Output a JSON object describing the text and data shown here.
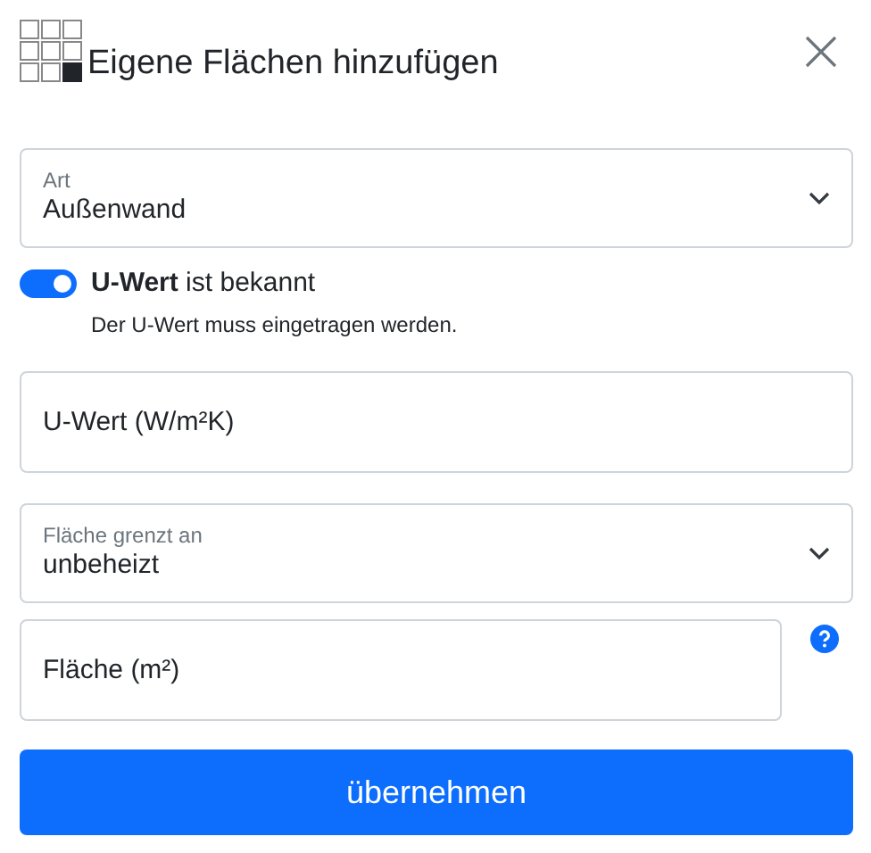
{
  "dialog": {
    "title": "Eigene Flächen hinzufügen"
  },
  "fields": [
    {
      "kind": "select",
      "label": "Art",
      "value": "Außenwand"
    },
    {
      "kind": "toggle",
      "label": "**U-Wert** ist bekannt",
      "on": true,
      "hint": "Der U-Wert muss eingetragen werden."
    },
    {
      "kind": "input",
      "placeholder": "U-Wert (W/m²K)",
      "help": false
    },
    {
      "kind": "select",
      "label": "Fläche grenzt an",
      "value": "unbeheizt"
    },
    {
      "kind": "input",
      "placeholder": "Fläche (m²)",
      "help": true
    }
  ],
  "submit": {
    "label": "übernehmen"
  }
}
